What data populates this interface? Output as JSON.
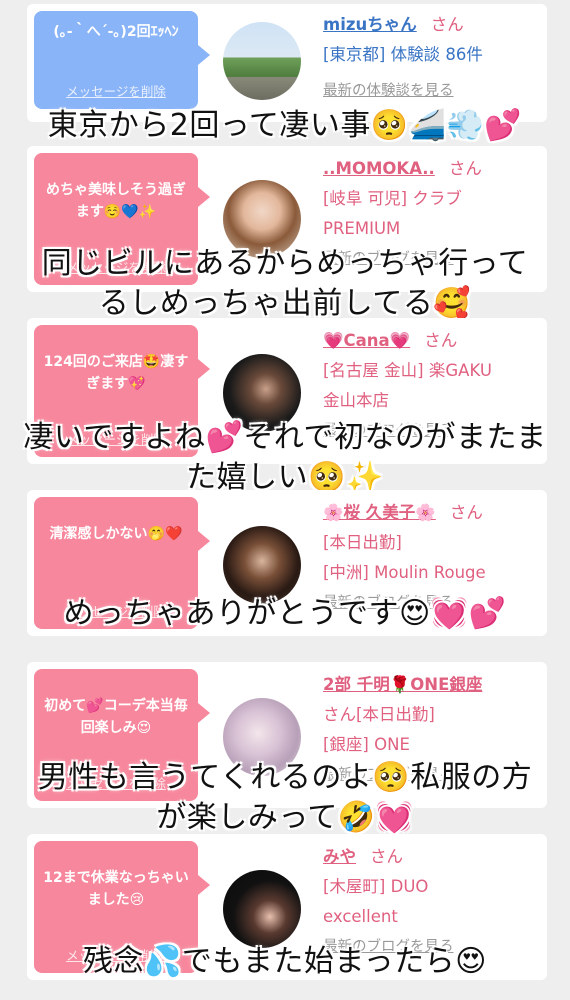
{
  "colors": {
    "blue_bubble": "#8ab4f8",
    "pink_bubble": "#f7879c",
    "pink_text": "#e06080",
    "blue_text": "#3a74c4"
  },
  "delete_label": "メッセージを削除",
  "cards": [
    {
      "bubble_text": "(｡-｀へ´-｡)2回ｴｯﾍﾝ",
      "bubble_color": "blue",
      "name": "mizuちゃん",
      "san": "さん",
      "line1": "[東京都] 体験談 86件",
      "line2": "",
      "more": "最新の体験談を見る",
      "avatar": "road-photo",
      "caption": "東京から2回って凄い事🥺🚄💨💕"
    },
    {
      "bubble_text": "めちゃ美味しそう過ぎます☺️💙✨",
      "bubble_color": "pink",
      "name": "..MOMOKA..",
      "san": "さん",
      "line1": "[岐阜 可児] クラブ",
      "line2": "PREMIUM",
      "more": "最新のブログを見る",
      "avatar": "woman-photo",
      "caption": "同じビルにあるからめっちゃ行って\nるしめっちゃ出前してる🥰"
    },
    {
      "bubble_text": "124回のご来店🤩凄すぎます💖",
      "bubble_color": "pink",
      "name": "💗Cana💗",
      "san": "さん",
      "line1": "[名古屋 金山] 楽GAKU",
      "line2": "金山本店",
      "more": "最新のブログを見る",
      "avatar": "woman-photo",
      "caption": "凄いですよね💕それで初なのがまたま\nた嬉しい🥺✨"
    },
    {
      "bubble_text": "清潔感しかない🤭❤️",
      "bubble_color": "pink",
      "name": "🌸桜 久美子🌸",
      "san": "さん",
      "line1": "[本日出勤]",
      "line2": "[中洲] Moulin Rouge",
      "more": "最新のブログを見る",
      "avatar": "woman-photo",
      "caption": "めっちゃありがとうです😍💓💕"
    },
    {
      "bubble_text": "初めて💕コーデ本当毎回楽しみ😍",
      "bubble_color": "pink",
      "name": "2部 千明🌹ONE銀座",
      "san": "",
      "line1": "さん[本日出勤]",
      "line2": "[銀座] ONE",
      "more": "最新のブログを見る",
      "avatar": "woman-photo",
      "caption": "男性も言うてくれるのよ🥺私服の方\nが楽しみって🤣💓"
    },
    {
      "bubble_text": "12まで休業なっちゃいました😢",
      "bubble_color": "pink",
      "name": "みや",
      "san": "さん",
      "line1": "[木屋町] DUO",
      "line2": "excellent",
      "more": "最新のブログを見る",
      "avatar": "woman-photo",
      "caption": "残念💦でもまた始まったら😍"
    }
  ]
}
